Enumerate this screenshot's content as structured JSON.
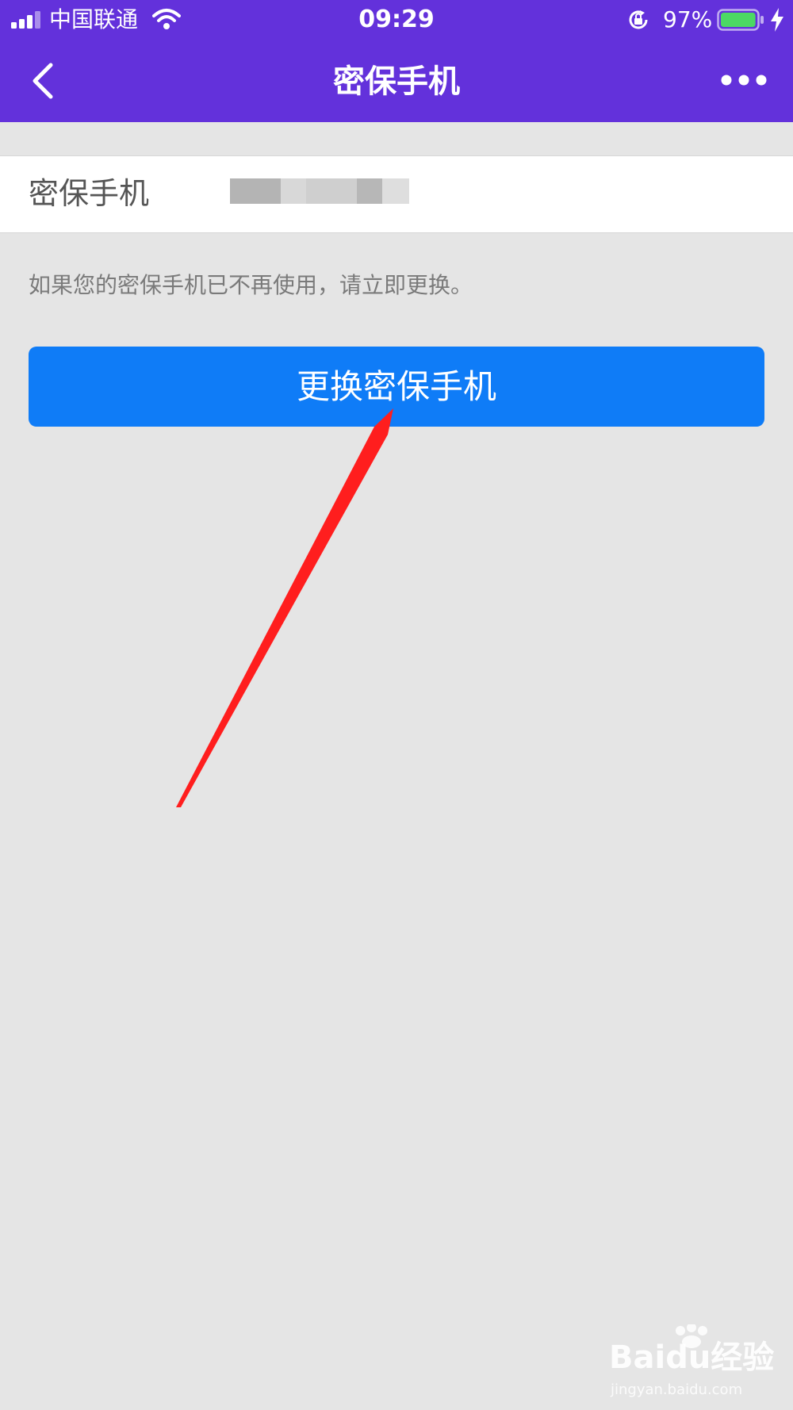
{
  "status_bar": {
    "carrier": "中国联通",
    "time": "09:29",
    "battery_percent": "97%",
    "battery_level": 0.97,
    "charging": true
  },
  "nav": {
    "title": "密保手机",
    "back_icon": "chevron-left-icon",
    "more_icon": "more-dots-icon"
  },
  "phone_row": {
    "label": "密保手机"
  },
  "hint": "如果您的密保手机已不再使用，请立即更换。",
  "change_button": {
    "label": "更换密保手机"
  },
  "watermark": {
    "brand": "Baidu经验",
    "url": "jingyan.baidu.com"
  },
  "colors": {
    "header": "#6331db",
    "page_background": "#e5e5e5",
    "button": "#0f7cf7",
    "annotation_arrow": "#ff1e1e"
  }
}
